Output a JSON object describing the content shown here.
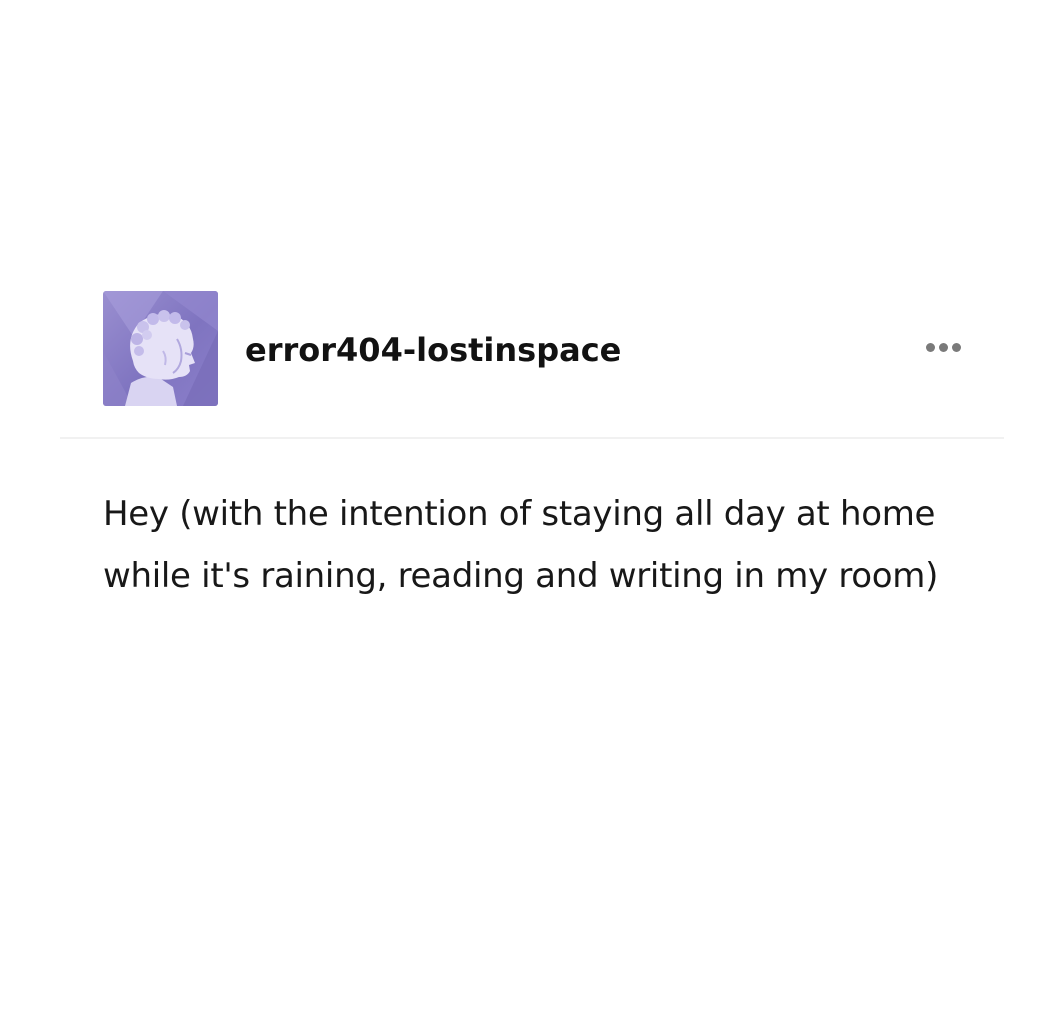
{
  "post": {
    "blog_name": "error404-lostinspace",
    "avatar_icon": "statue-head-avatar",
    "more_icon": "more-options-icon",
    "body_text": "Hey (with the intention of staying all day at home while it's raining, reading and writing in my room)"
  },
  "colors": {
    "avatar_purple": "#8b7fca",
    "text": "#181818",
    "divider": "#f1f1f1",
    "dots": "#7a7a7a"
  }
}
